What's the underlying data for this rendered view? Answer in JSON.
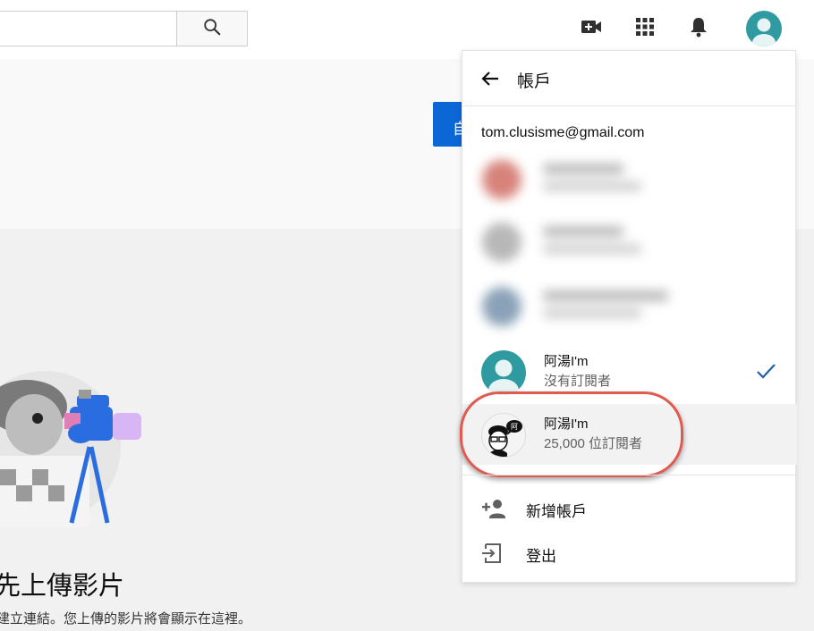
{
  "masthead": {
    "search_icon": "search-icon",
    "create_icon": "video-camera-plus-icon",
    "apps_icon": "apps-grid-icon",
    "notifications_icon": "bell-icon"
  },
  "background": {
    "blue_button_label": "自",
    "upload_heading": "先上傳影片",
    "upload_subtext": "建立連結。您上傳的影片將會顯示在這裡。"
  },
  "account_panel": {
    "title": "帳戶",
    "email": "tom.clusisme@gmail.com",
    "accounts": [
      {
        "name": "阿湯I'm",
        "subscribers": "沒有訂閱者",
        "selected": true
      },
      {
        "name": "阿湯I'm",
        "subscribers": "25,000 位訂閱者",
        "selected": false,
        "highlighted": true
      }
    ],
    "menu": [
      {
        "label": "新增帳戶",
        "icon": "add-person-icon"
      },
      {
        "label": "登出",
        "icon": "sign-out-icon"
      }
    ]
  },
  "colors": {
    "accent_blue": "#065fd4",
    "avatar_teal": "#2f9aa0",
    "highlight_red": "#e05a4f"
  }
}
